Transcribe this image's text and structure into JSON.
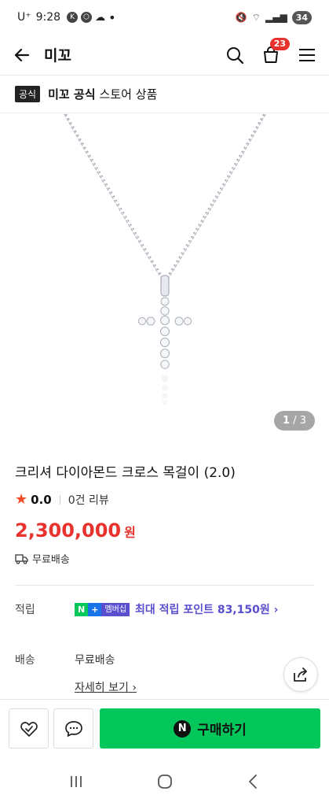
{
  "status": {
    "carrier": "U⁺",
    "time": "9:28",
    "battery": "34"
  },
  "header": {
    "title": "미꼬",
    "cart_count": "23"
  },
  "store": {
    "badge": "공식",
    "name": "미꼬 공식",
    "suffix": "스토어 상품"
  },
  "gallery": {
    "current": "1",
    "total": "3"
  },
  "product": {
    "name": "크리셔 다이아몬드 크로스 목걸이 (2.0)",
    "rating": "0.0",
    "reviews": "0건 리뷰",
    "price": "2,300,000",
    "currency": "원",
    "shipping": "무료배송"
  },
  "points": {
    "label": "적립",
    "badge_n": "N",
    "badge_plus": "+",
    "badge_member": "멤버십",
    "text": "최대 적립 포인트 83,150원"
  },
  "delivery": {
    "label": "배송",
    "value": "무료배송",
    "detail_link": "자세히 보기"
  },
  "bottom": {
    "buy_label": "구매하기",
    "buy_logo": "N"
  },
  "colors": {
    "accent_red": "#e8322d",
    "naver_green": "#03c75a",
    "membership_purple": "#5a4fcf"
  }
}
